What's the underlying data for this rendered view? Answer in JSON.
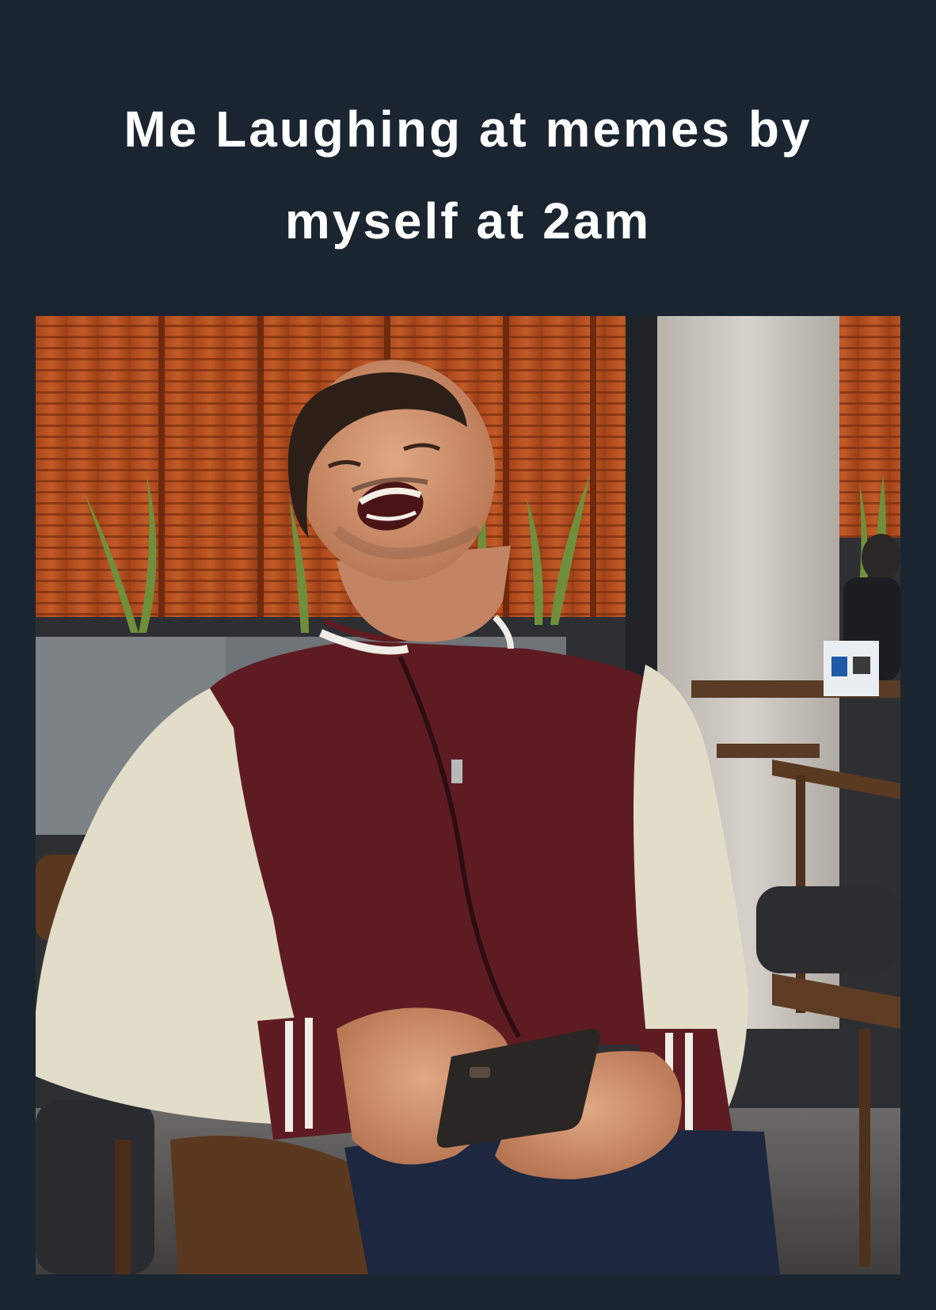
{
  "caption": {
    "line1": "Me Laughing at memes by",
    "line2": "myself at 2am"
  },
  "photo": {
    "subject": "man-laughing-in-varsity-jacket-holding-phone"
  },
  "colors": {
    "background": "#1a2530",
    "caption_text": "#ffffff"
  }
}
